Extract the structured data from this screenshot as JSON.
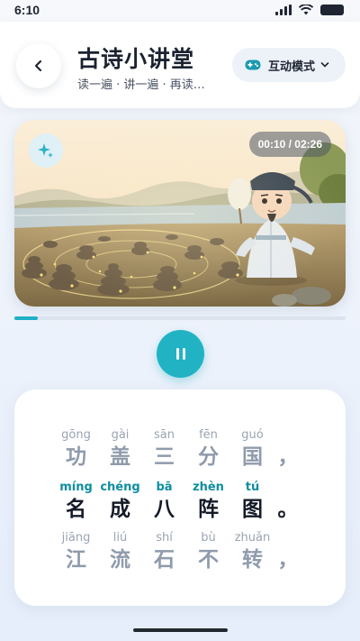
{
  "status": {
    "time": "6:10"
  },
  "header": {
    "title": "古诗小讲堂",
    "subtitle": "读一遍 · 讲一遍 · 再读…",
    "mode_label": "互动模式"
  },
  "video": {
    "time": "00:10 / 02:26",
    "progress": 0.07
  },
  "poem": {
    "lines": [
      {
        "state": "dim",
        "chars": [
          {
            "py": "gōng",
            "hz": "功"
          },
          {
            "py": "gài",
            "hz": "盖"
          },
          {
            "py": "sān",
            "hz": "三"
          },
          {
            "py": "fēn",
            "hz": "分"
          },
          {
            "py": "guó",
            "hz": "国"
          }
        ],
        "punc": "，"
      },
      {
        "state": "active",
        "chars": [
          {
            "py": "míng",
            "hz": "名"
          },
          {
            "py": "chéng",
            "hz": "成"
          },
          {
            "py": "bā",
            "hz": "八"
          },
          {
            "py": "zhèn",
            "hz": "阵"
          },
          {
            "py": "tú",
            "hz": "图"
          }
        ],
        "punc": "。"
      },
      {
        "state": "dim",
        "chars": [
          {
            "py": "jiāng",
            "hz": "江"
          },
          {
            "py": "liú",
            "hz": "流"
          },
          {
            "py": "shí",
            "hz": "石"
          },
          {
            "py": "bù",
            "hz": "不"
          },
          {
            "py": "zhuǎn",
            "hz": "转"
          }
        ],
        "punc": "，"
      }
    ]
  },
  "icons": {
    "back": "chevron-left-icon",
    "mode": "gamepad-icon",
    "dropdown": "chevron-down-icon",
    "badge": "sparkle-icon",
    "play": "pause-icon"
  },
  "colors": {
    "accent": "#21b3c4",
    "pinyin_active": "#0d8ea0"
  }
}
